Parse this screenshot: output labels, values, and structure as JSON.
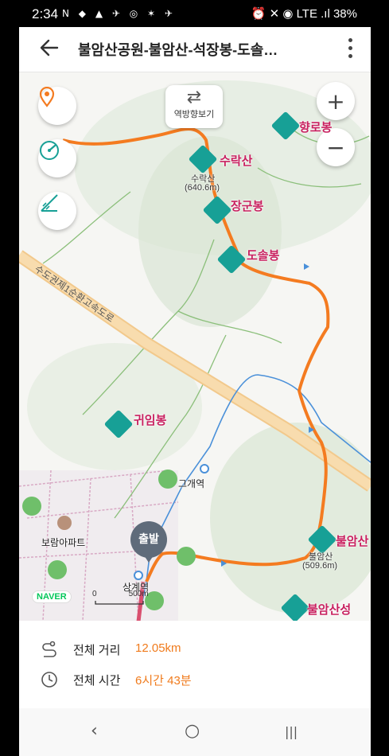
{
  "status": {
    "time": "2:34",
    "left_icons": "N ◆ ▲ ✈ ◎ ✶ ✈",
    "right": "⏰ ✕ ◉ LTE .ıl 38%"
  },
  "header": {
    "back_icon": "arrow-left-icon",
    "title": "불암산공원-불암산-석장봉-도솔…"
  },
  "map": {
    "reverse_label": "역방향보기",
    "zoom_in": "+",
    "zoom_out": "−",
    "peaks": [
      {
        "name": "향로봉"
      },
      {
        "name": "수락산",
        "sub": "수락산"
      },
      {
        "name": "장군봉"
      },
      {
        "name": "도솔봉"
      },
      {
        "name": "귀임봉"
      },
      {
        "name": "불암산",
        "sub": "불암산",
        "sub2": "(509.6m)"
      },
      {
        "name": "불암산성"
      }
    ],
    "suraksan_elev": "(640.6m)",
    "places": {
      "station1": "그개역",
      "apartment": "보람아파트",
      "station2": "상계역"
    },
    "road": "수도권제1순환고속도로",
    "start_badge": "출발",
    "naver": "NAVER",
    "scale_zero": "0",
    "scale_dist": "500m"
  },
  "summary": {
    "distance_label": "전체 거리",
    "distance_value": "12.05km",
    "time_label": "전체 시간",
    "time_value": "6시간 43분"
  },
  "nav": {
    "back": "‹",
    "home": "○",
    "recents": "|||"
  },
  "colors": {
    "route": "#f47b20",
    "peak": "#c8205f",
    "accent": "#f07b1d",
    "mountain_icon": "#17a096"
  }
}
